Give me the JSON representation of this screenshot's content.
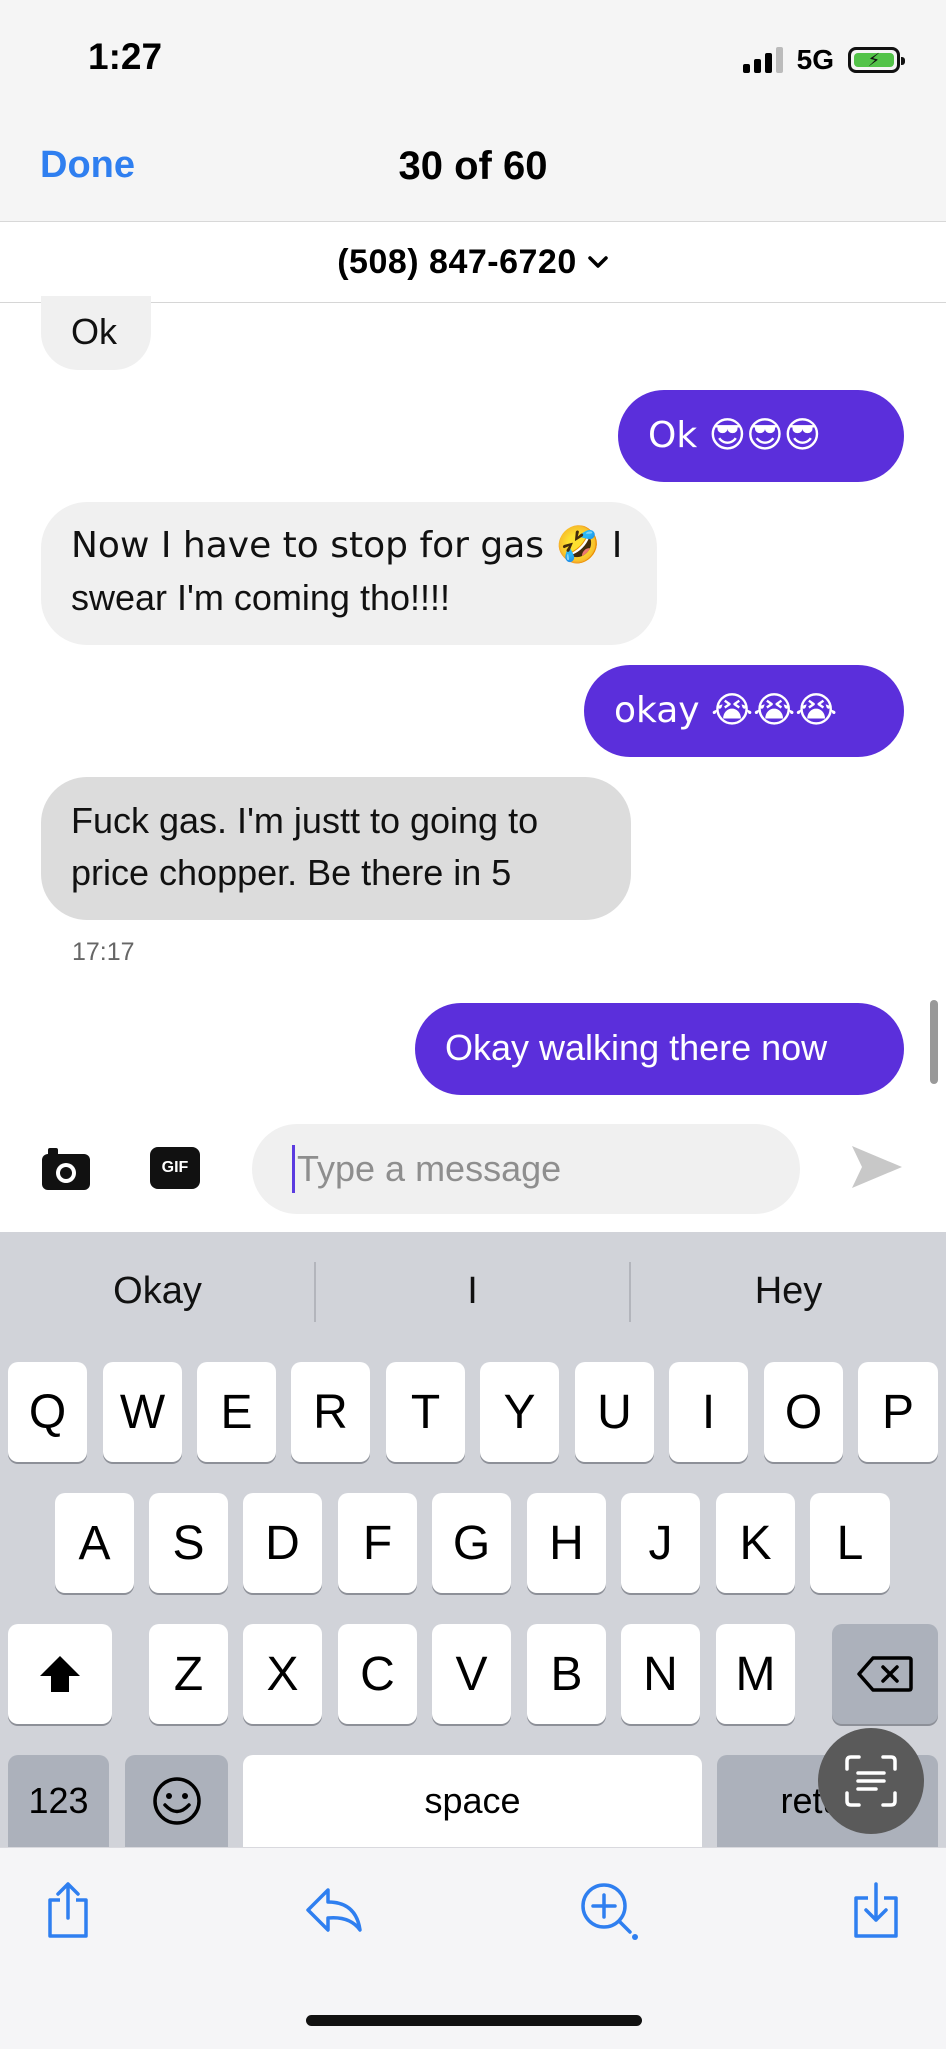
{
  "status_bar": {
    "time": "1:27",
    "network": "5G"
  },
  "header": {
    "done_label": "Done",
    "counter": "30 of 60"
  },
  "contact": {
    "name": "(508) 847-6720"
  },
  "messages": [
    {
      "direction": "in",
      "text": "Ok"
    },
    {
      "direction": "out",
      "text": "Ok 😎😎😎"
    },
    {
      "direction": "in",
      "text": "Now I have to stop for gas 🤣 I swear I'm coming tho!!!!",
      "line1": "Now I have to stop for gas 🤣 I",
      "line2": "swear I'm coming tho!!!!"
    },
    {
      "direction": "out",
      "text": "okay 😭😭😭"
    },
    {
      "direction": "in",
      "text": "Fuck gas. I'm justt to going to price chopper. Be there in 5",
      "line1": "Fuck gas. I'm justt to going to",
      "line2": "price chopper. Be there in 5"
    },
    {
      "direction": "timestamp",
      "text": "17:17"
    },
    {
      "direction": "out",
      "text": "Okay walking there now"
    }
  ],
  "composer": {
    "placeholder": "Type a message",
    "gif_label": "GIF"
  },
  "keyboard": {
    "suggestions": [
      "Okay",
      "I",
      "Hey"
    ],
    "row1": [
      "Q",
      "W",
      "E",
      "R",
      "T",
      "Y",
      "U",
      "I",
      "O",
      "P"
    ],
    "row2": [
      "A",
      "S",
      "D",
      "F",
      "G",
      "H",
      "J",
      "K",
      "L"
    ],
    "row3": [
      "Z",
      "X",
      "C",
      "V",
      "B",
      "N",
      "M"
    ],
    "numbers_label": "123",
    "space_label": "space",
    "return_label": "return"
  },
  "toolbar": {
    "icons": [
      "share-icon",
      "reply-icon",
      "zoom-in-icon",
      "download-icon"
    ]
  },
  "colors": {
    "accent": "#2f7ff0",
    "outgoing_bubble": "#5b2fdb",
    "incoming_bubble": "#f0f0f0"
  }
}
